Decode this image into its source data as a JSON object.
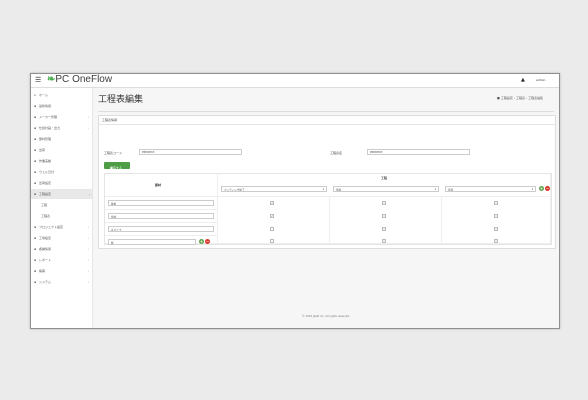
{
  "app": {
    "logo_prefix": "PC ",
    "logo_rest": "OneFlow",
    "user": "admin"
  },
  "sidebar": {
    "items": [
      {
        "label": "ホーム",
        "icon": "home-icon",
        "glyph": "⌂",
        "arrow": ""
      },
      {
        "label": "最新情報",
        "icon": "news-icon",
        "glyph": "▪",
        "arrow": ""
      },
      {
        "label": "メーカー管理",
        "icon": "maker-icon",
        "glyph": "▪",
        "arrow": "‹"
      },
      {
        "label": "仕様計画・出力",
        "icon": "spec-icon",
        "glyph": "▪",
        "arrow": "‹"
      },
      {
        "label": "部材管理",
        "icon": "material-icon",
        "glyph": "▪",
        "arrow": ""
      },
      {
        "label": "出荷",
        "icon": "shipping-icon",
        "glyph": "▪",
        "arrow": ""
      },
      {
        "label": "作業実績",
        "icon": "work-icon",
        "glyph": "▪",
        "arrow": ""
      },
      {
        "label": "ウェル日付",
        "icon": "calendar-icon",
        "glyph": "▪",
        "arrow": ""
      },
      {
        "label": "出荷設定",
        "icon": "ship-setting-icon",
        "glyph": "▪",
        "arrow": ""
      },
      {
        "label": "工程設定",
        "icon": "process-icon",
        "glyph": "▪",
        "arrow": "⌄"
      },
      {
        "label": "工程",
        "icon": "",
        "glyph": "",
        "arrow": ""
      },
      {
        "label": "工程表",
        "icon": "",
        "glyph": "",
        "arrow": ""
      },
      {
        "label": "プロジェクト設定",
        "icon": "project-icon",
        "glyph": "▪",
        "arrow": "‹"
      },
      {
        "label": "工場設定",
        "icon": "factory-icon",
        "glyph": "▪",
        "arrow": "‹"
      },
      {
        "label": "各種情報",
        "icon": "info-icon",
        "glyph": "▪",
        "arrow": "‹"
      },
      {
        "label": "レポート",
        "icon": "report-icon",
        "glyph": "▪",
        "arrow": "‹"
      },
      {
        "label": "帳票",
        "icon": "form-icon",
        "glyph": "▪",
        "arrow": "‹"
      },
      {
        "label": "システム",
        "icon": "system-icon",
        "glyph": "▪",
        "arrow": "‹"
      }
    ]
  },
  "page": {
    "title": "工程表編集",
    "breadcrumb": [
      "工程設定",
      "工程表",
      "工程表編集"
    ]
  },
  "panel": {
    "heading": "工程表情報",
    "code_label": "工程表コード",
    "code_value": "PRMCE03",
    "name_label": "工程表名",
    "name_value": "PRMCE03",
    "save_label": "保存する"
  },
  "table": {
    "material_header": "部材",
    "process_header": "工程",
    "processes": [
      "カッティング加工",
      "溶接",
      "塗装"
    ],
    "rows": [
      {
        "material": "鉄板",
        "checks": [
          true,
          false,
          false
        ]
      },
      {
        "material": "角材",
        "checks": [
          true,
          false,
          false
        ]
      },
      {
        "material": "丸パイプ",
        "checks": [
          false,
          false,
          false
        ]
      },
      {
        "material": "板",
        "checks": [
          false,
          false,
          false
        ]
      }
    ]
  },
  "footer": "© 2019 gkaP Inc. All rights reserved."
}
